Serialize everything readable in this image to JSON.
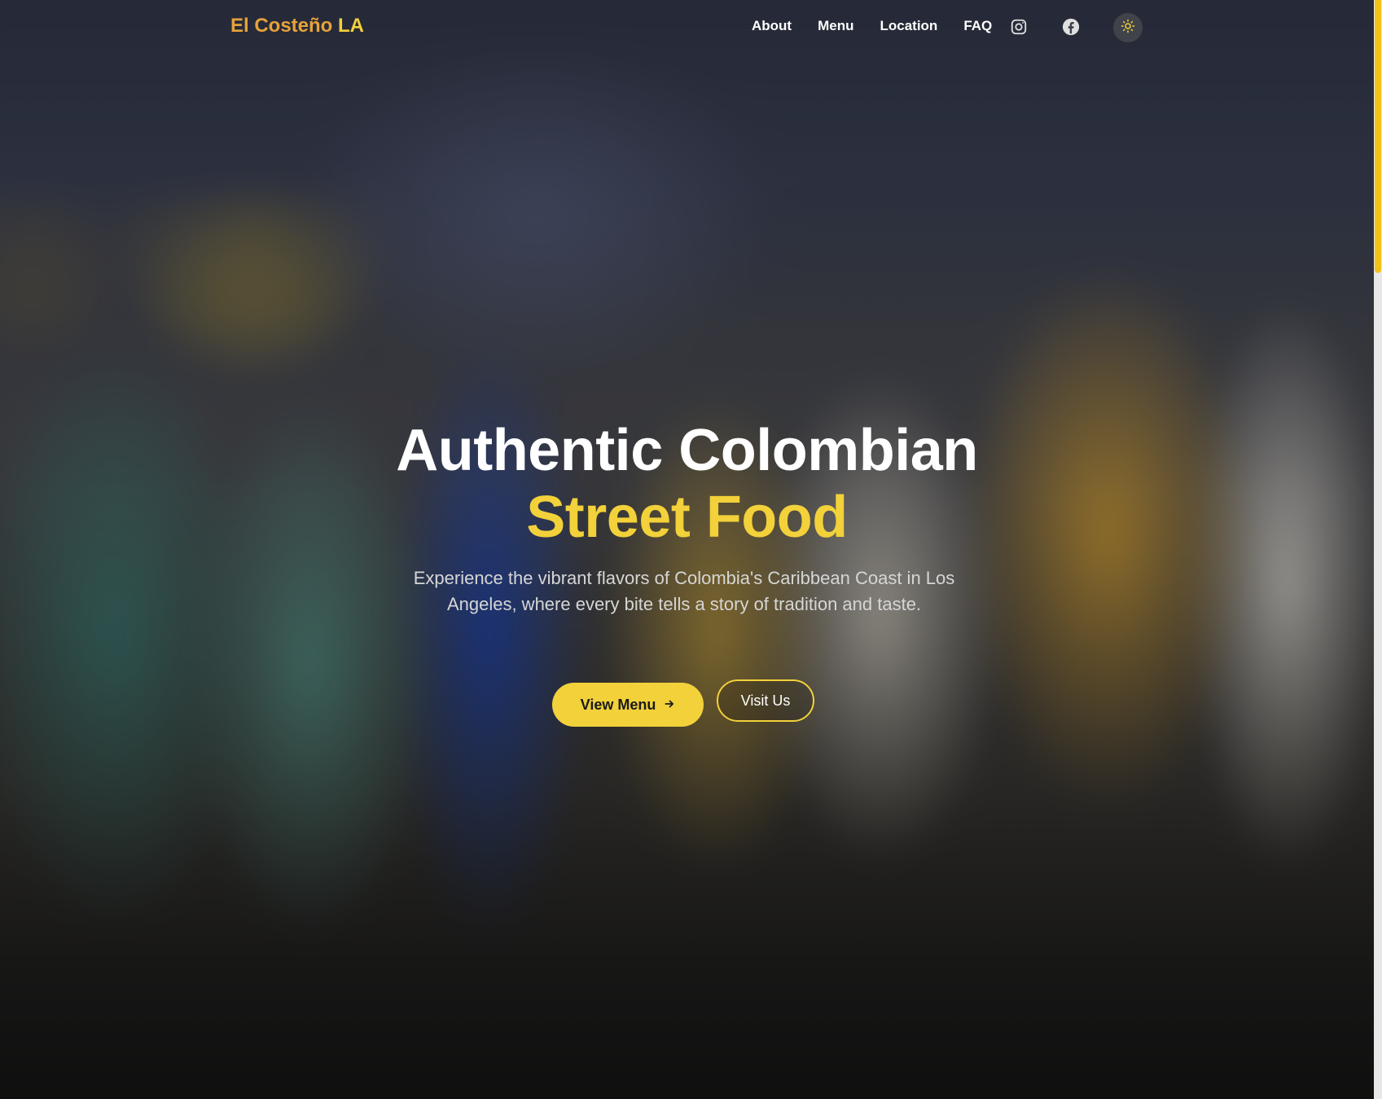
{
  "nav": {
    "brand_part1": "El Costeño",
    "brand_part2": "LA",
    "links": [
      "About",
      "Menu",
      "Location",
      "FAQ"
    ],
    "icons": [
      "instagram-icon",
      "facebook-icon",
      "sun-icon"
    ]
  },
  "hero": {
    "title_line1": "Authentic Colombian",
    "title_line2": "Street Food",
    "subtitle": "Experience the vibrant flavors of Colombia's Caribbean Coast in Los Angeles, where every bite tells a story of tradition and taste.",
    "primary_button": "View Menu",
    "secondary_button": "Visit Us"
  },
  "colors": {
    "accent_yellow": "#f2d13a",
    "brand_orange": "#e6a23a"
  }
}
